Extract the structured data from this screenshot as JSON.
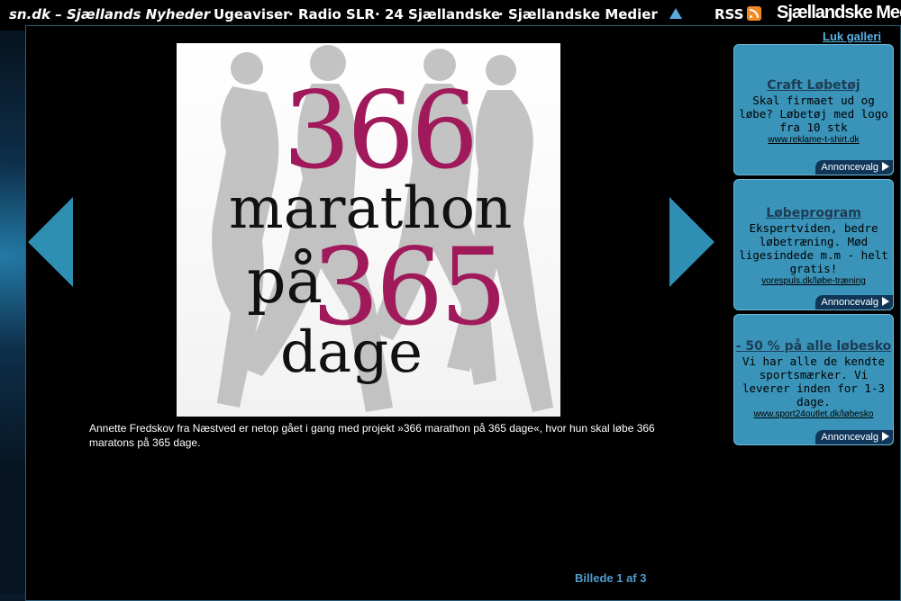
{
  "nav": {
    "site": "sn.dk – Sjællands Nyheder",
    "items": [
      "Ugeaviser",
      "Radio SLR",
      "24 Sjællandske",
      "Sjællandske Medier"
    ],
    "rss": "RSS",
    "brand": "Sjællandske Medie"
  },
  "gallery": {
    "close_label": "Luk galleri",
    "image": {
      "line1": "366",
      "line2": "marathon",
      "line3a": "på",
      "line3b": "365",
      "line4": "dage"
    },
    "caption": "Annette Fredskov fra Næstved er netop gået i gang med projekt »366 marathon på 365 dage«, hvor hun skal løbe 366 maratons på 365 dage.",
    "counter": "Billede 1 af 3"
  },
  "ads": [
    {
      "title": "Craft Løbetøj",
      "text": "Skal firmaet ud og løbe? Løbetøj med logo fra 10 stk",
      "url": "www.reklame-t-shirt.dk",
      "choice": "Annoncevalg"
    },
    {
      "title": "Løbeprogram",
      "text": "Ekspertviden, bedre løbetræning. Mød ligesindede m.m - helt gratis!",
      "url": "vorespuls.dk/løbe-træning",
      "choice": "Annoncevalg"
    },
    {
      "title": "- 50 % på alle løbesko",
      "text": "Vi har alle de kendte sportsmærker. Vi leverer inden for 1-3 dage.",
      "url": "www.sport24outlet.dk/løbesko",
      "choice": "Annoncevalg"
    }
  ],
  "colors": {
    "accent": "#2f8fb3",
    "ad_bg": "#3a94b9",
    "title_pink": "#a0195a"
  }
}
